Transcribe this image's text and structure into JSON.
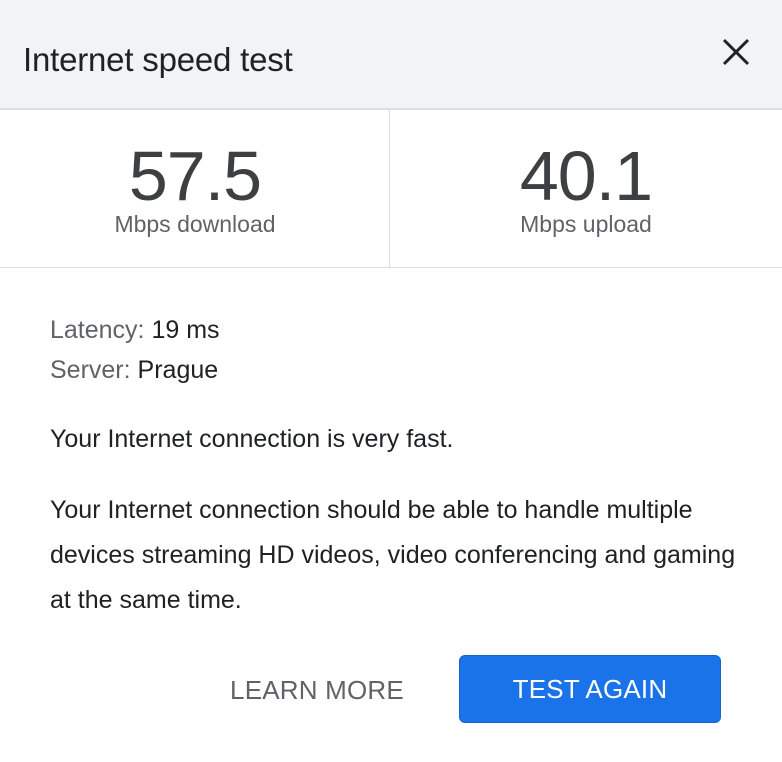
{
  "dialog": {
    "title": "Internet speed test",
    "close_icon": "close-icon"
  },
  "results": {
    "download": {
      "value": "57.5",
      "unit": "Mbps download"
    },
    "upload": {
      "value": "40.1",
      "unit": "Mbps upload"
    }
  },
  "details": {
    "latency_label": "Latency:",
    "latency_value": "19 ms",
    "server_label": "Server:",
    "server_value": "Prague"
  },
  "verdict": "Your Internet connection is very fast.",
  "description": "Your Internet connection should be able to handle multiple devices streaming HD videos, video conferencing and gaming at the same time.",
  "actions": {
    "learn_more": "LEARN MORE",
    "test_again": "TEST AGAIN"
  },
  "colors": {
    "header_bg": "#f1f3f4",
    "primary": "#1a73e8",
    "text": "#202124",
    "secondary_text": "#5f6368",
    "divider": "#dadce0"
  }
}
